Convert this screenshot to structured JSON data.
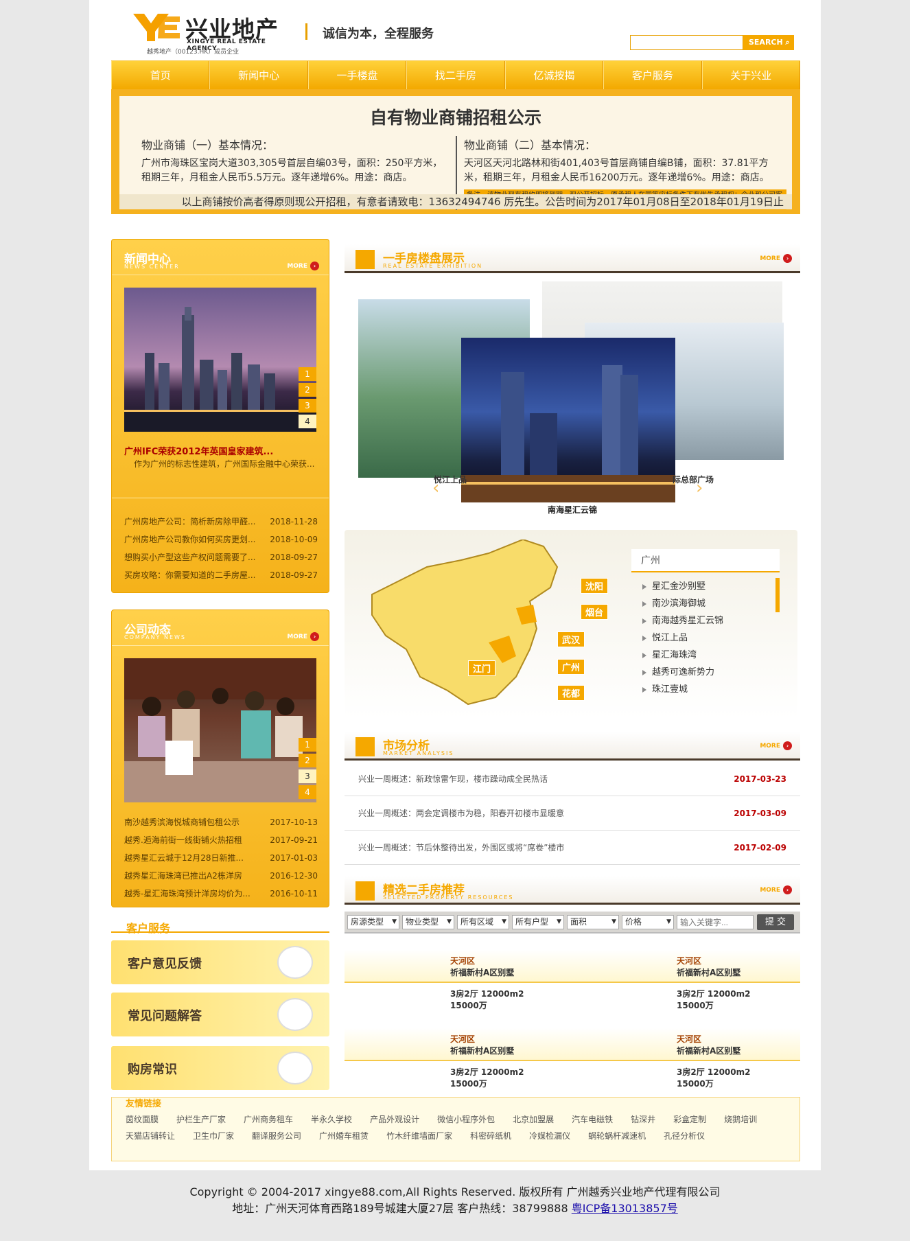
{
  "header": {
    "logo_cn": "兴业地产",
    "logo_en": "XINGYE REAL ESTATE AGENCY",
    "logo_sub": "越秀地产（00123.HK）成员企业",
    "slogan": "诚信为本，全程服务",
    "search_btn": "SEARCH",
    "search_placeholder": ""
  },
  "nav": [
    "首页",
    "新闻中心",
    "一手楼盘",
    "找二手房",
    "亿诚按揭",
    "客户服务",
    "关于兴业"
  ],
  "banner": {
    "title": "自有物业商铺招租公示",
    "col1_h": "物业商铺（一）基本情况：",
    "col1_t": "广州市海珠区宝岗大道303,305号首层自编03号，面积：250平方米，租期三年，月租金人民币5.5万元。逐年递增6%。用途：商店。",
    "col2_h": "物业商铺（二）基本情况：",
    "col2_t": "天河区天河北路林和街401,403号首层商铺自编B铺，面积：37.81平方米，租期三年，月租金人民币16200万元。逐年递增6%。用途：商店。",
    "col2_note": "备注，该物业现有租约即将到期，现公开招标，原承租人在同等应标条件下有优先承租权；企业和公司客户优先。",
    "foot": "以上商铺按价高者得原则现公开招租，有意者请致电：13632494746 厉先生。公告时间为2017年01月08日至2018年01月19日止"
  },
  "news": {
    "title": "新闻中心",
    "en": "NEWS CENTER",
    "more": "MORE",
    "nums": [
      "1",
      "2",
      "3",
      "4"
    ],
    "headline": "广州IFC荣获2012年英国皇家建筑...",
    "summary": "作为广州的标志性建筑，广州国际金融中心荣获...",
    "items": [
      {
        "t": "广州房地产公司：简析新房除甲醛...",
        "d": "2018-11-28"
      },
      {
        "t": "广州房地产公司教你如何买房更划...",
        "d": "2018-10-09"
      },
      {
        "t": "想购买小产型这些产权问题需要了...",
        "d": "2018-09-27"
      },
      {
        "t": "买房攻略：你需要知道的二手房屋...",
        "d": "2018-09-27"
      }
    ]
  },
  "company": {
    "title": "公司动态",
    "en": "COMPANY NEWS",
    "more": "MORE",
    "nums": [
      "1",
      "2",
      "3",
      "4"
    ],
    "items": [
      {
        "t": "南沙越秀滨海悦城商铺包租公示",
        "d": "2017-10-13"
      },
      {
        "t": "越秀.逅海前街一线街铺火热招租",
        "d": "2017-09-21"
      },
      {
        "t": "越秀星汇云城于12月28日新推...",
        "d": "2017-01-03"
      },
      {
        "t": "越秀星汇海珠湾已推出A2栋洋房",
        "d": "2016-12-30"
      },
      {
        "t": "越秀-星汇海珠湾预计洋房均价为...",
        "d": "2016-10-11"
      }
    ]
  },
  "service": {
    "title": "客户服务",
    "items": [
      "客户意见反馈",
      "常见问题解答",
      "购房常识"
    ]
  },
  "estate": {
    "title": "一手房楼盘展示",
    "en": "REAL ESTATE EXHIBITION",
    "more": "MORE",
    "caption": "南海星汇云锦",
    "left_label": "悦江上品",
    "right_label": "际总部广场"
  },
  "map": {
    "tab": "广州",
    "cities": [
      "沈阳",
      "烟台",
      "武汉",
      "江门",
      "广州",
      "花都"
    ],
    "items": [
      "星汇金沙别墅",
      "南沙滨海御城",
      "南海越秀星汇云锦",
      "悦江上品",
      "星汇海珠湾",
      "越秀可逸新势力",
      "珠江壹城"
    ]
  },
  "market": {
    "title": "市场分析",
    "en": "MARKET ANALYSIS",
    "more": "MORE",
    "items": [
      {
        "t": "兴业一周概述：新政惊雷乍现，楼市躁动成全民热话",
        "d": "2017-03-23"
      },
      {
        "t": "兴业一周概述：两会定调楼市为稳，阳春开初楼市显暖意",
        "d": "2017-03-09"
      },
      {
        "t": "兴业一周概述：节后休整待出发，外围区或将“席卷”楼市",
        "d": "2017-02-09"
      }
    ]
  },
  "second": {
    "title": "精选二手房推荐",
    "en": "SELECTED PROPERTY RESOURCES",
    "more": "MORE",
    "filters": [
      "房源类型",
      "物业类型",
      "所有区域",
      "所有户型",
      "面积",
      "价格"
    ],
    "keyword_placeholder": "输入关键字...",
    "submit": "提 交",
    "props": [
      {
        "area": "天河区",
        "name": "祈福新村A区别墅",
        "spec": "3房2厅 12000m2",
        "price": "15000万"
      },
      {
        "area": "天河区",
        "name": "祈福新村A区别墅",
        "spec": "3房2厅 12000m2",
        "price": "15000万"
      },
      {
        "area": "天河区",
        "name": "祈福新村A区别墅",
        "spec": "3房2厅 12000m2",
        "price": "15000万"
      },
      {
        "area": "天河区",
        "name": "祈福新村A区别墅",
        "spec": "3房2厅 12000m2",
        "price": "15000万"
      }
    ]
  },
  "links": {
    "title": "友情链接",
    "items": [
      "茵纹面膜",
      "护栏生产厂家",
      "广州商务租车",
      "半永久学校",
      "产品外观设计",
      "微信小程序外包",
      "北京加盟展",
      "汽车电磁铁",
      "钻深井",
      "彩盒定制",
      "烧鹅培训",
      "天猫店铺转让",
      "卫生巾厂家",
      "翻译服务公司",
      "广州婚车租赁",
      "竹木纤维墙面厂家",
      "科密碎纸机",
      "冷媒检漏仪",
      "蜗轮蜗杆减速机",
      "孔径分析仪"
    ]
  },
  "footer": {
    "line1": "Copyright © 2004-2017 xingye88.com,All Rights Reserved. 版权所有 广州越秀兴业地产代理有限公司",
    "line2": "地址：广州天河体育西路189号城建大厦27层 客户热线：38799888",
    "icp": "粤ICP备13013857号"
  }
}
